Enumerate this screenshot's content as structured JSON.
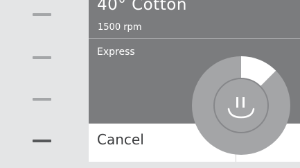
{
  "program": {
    "title": "40° Cotton",
    "spin": "1500 rpm",
    "mode": "Express"
  },
  "actions": {
    "cancel_label": "Cancel"
  },
  "progress": {
    "fraction": 0.125
  },
  "icons": {
    "pause": "pause-icon"
  },
  "colors": {
    "panel": "#7b7c7e",
    "dial": "#a4a5a7",
    "dial_progress": "#ffffff",
    "rail": "#e4e5e6",
    "rail_active": "#56585a"
  }
}
